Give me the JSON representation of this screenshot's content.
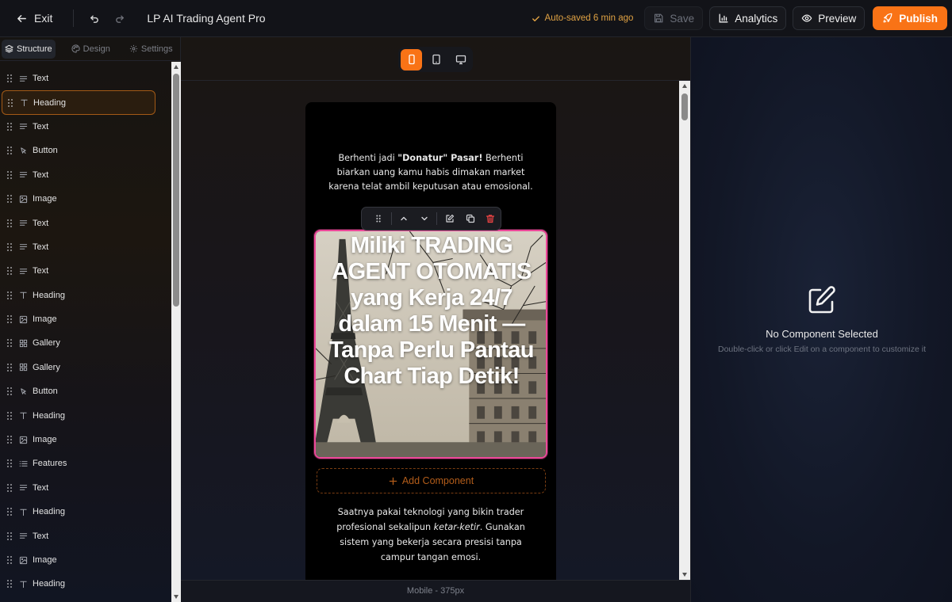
{
  "topbar": {
    "exit_label": "Exit",
    "project_title": "LP AI Trading Agent Pro",
    "autosave_text": "Auto-saved 6 min ago",
    "save_label": "Save",
    "analytics_label": "Analytics",
    "preview_label": "Preview",
    "publish_label": "Publish"
  },
  "sidebar": {
    "tabs": [
      {
        "label": "Structure",
        "icon": "layers-icon"
      },
      {
        "label": "Design",
        "icon": "palette-icon"
      },
      {
        "label": "Settings",
        "icon": "gear-icon"
      }
    ],
    "items": [
      {
        "label": "Text",
        "icon": "text-lines-icon"
      },
      {
        "label": "Heading",
        "icon": "heading-t-icon"
      },
      {
        "label": "Text",
        "icon": "text-lines-icon"
      },
      {
        "label": "Button",
        "icon": "pointer-icon"
      },
      {
        "label": "Text",
        "icon": "text-lines-icon"
      },
      {
        "label": "Image",
        "icon": "image-icon"
      },
      {
        "label": "Text",
        "icon": "text-lines-icon"
      },
      {
        "label": "Text",
        "icon": "text-lines-icon"
      },
      {
        "label": "Text",
        "icon": "text-lines-icon"
      },
      {
        "label": "Heading",
        "icon": "heading-t-icon"
      },
      {
        "label": "Image",
        "icon": "image-icon"
      },
      {
        "label": "Gallery",
        "icon": "grid-icon"
      },
      {
        "label": "Gallery",
        "icon": "grid-icon"
      },
      {
        "label": "Button",
        "icon": "pointer-icon"
      },
      {
        "label": "Heading",
        "icon": "heading-t-icon"
      },
      {
        "label": "Image",
        "icon": "image-icon"
      },
      {
        "label": "Features",
        "icon": "list-icon"
      },
      {
        "label": "Text",
        "icon": "text-lines-icon"
      },
      {
        "label": "Heading",
        "icon": "heading-t-icon"
      },
      {
        "label": "Text",
        "icon": "text-lines-icon"
      },
      {
        "label": "Image",
        "icon": "image-icon"
      },
      {
        "label": "Heading",
        "icon": "heading-t-icon"
      }
    ],
    "selected_index": 1
  },
  "canvas": {
    "active_device": "mobile",
    "viewport_label": "Mobile - 375px",
    "intro_text_pre": "Berhenti jadi ",
    "intro_text_bold": "\"Donatur\" Pasar!",
    "intro_text_post": " Berhenti biarkan uang kamu habis dimakan market karena telat ambil keputusan atau emosional.",
    "hero_heading": "Miliki TRADING AGENT OTOMATIS yang Kerja 24/7 dalam 15 Menit — Tanpa Perlu Pantau Chart Tiap Detik!",
    "add_component_label": "Add Component",
    "body_text_pre": "Saatnya pakai teknologi yang bikin trader profesional sekalipun ",
    "body_text_italic": "ketar-ketir",
    "body_text_post": ". Gunakan sistem yang bekerja secara presisi tanpa campur tangan emosi."
  },
  "right_panel": {
    "empty_title": "No Component Selected",
    "empty_subtitle": "Double-click or click Edit on a component to customize it"
  },
  "colors": {
    "accent": "#f97316",
    "selection_outline": "#ec4899",
    "autosave": "#e0a243",
    "delete": "#ef4444"
  }
}
